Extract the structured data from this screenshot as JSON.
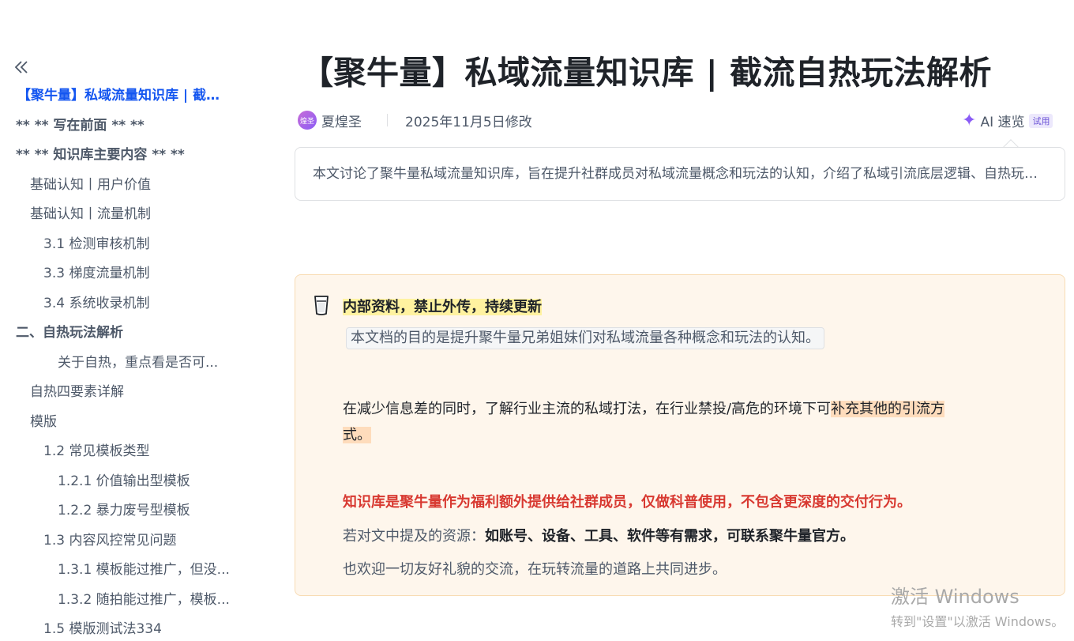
{
  "sidebar": {
    "toc": [
      {
        "label": "【聚牛量】私域流量知识库 | 截流自热玩法解析",
        "level": 0,
        "style": "active"
      },
      {
        "label": "** ** 写在前面 ** **",
        "level": 0,
        "style": "bold"
      },
      {
        "label": "** ** 知识库主要内容 ** **",
        "level": 0,
        "style": "bold"
      },
      {
        "label": "基础认知丨用户价值",
        "level": 1,
        "style": ""
      },
      {
        "label": "基础认知丨流量机制",
        "level": 1,
        "style": ""
      },
      {
        "label": "3.1 检测审核机制",
        "level": 2,
        "style": ""
      },
      {
        "label": "3.3 梯度流量机制",
        "level": 2,
        "style": ""
      },
      {
        "label": "3.4 系统收录机制",
        "level": 2,
        "style": ""
      },
      {
        "label": "二、自热玩法解析",
        "level": 0,
        "style": "bold"
      },
      {
        "label": "关于自热，重点看是否可...",
        "level": 3,
        "style": ""
      },
      {
        "label": "自热四要素详解",
        "level": 1,
        "style": ""
      },
      {
        "label": "模版",
        "level": 1,
        "style": ""
      },
      {
        "label": "1.2 常见模板类型",
        "level": 2,
        "style": ""
      },
      {
        "label": "1.2.1 价值输出型模板",
        "level": 3,
        "style": ""
      },
      {
        "label": "1.2.2 暴力废号型模板",
        "level": 3,
        "style": ""
      },
      {
        "label": "1.3 内容风控常见问题",
        "level": 2,
        "style": ""
      },
      {
        "label": "1.3.1 模板能过推广，但没...",
        "level": 3,
        "style": ""
      },
      {
        "label": "1.3.2 随拍能过推广，模板...",
        "level": 3,
        "style": ""
      },
      {
        "label": "1.5 模版测试法334",
        "level": 2,
        "style": ""
      }
    ]
  },
  "doc": {
    "title": "【聚牛量】私域流量知识库 | 截流自热玩法解析",
    "avatar_text": "煌圣",
    "author": "夏煌圣",
    "modified": "2025年11月5日修改",
    "ai_label": "AI 速览",
    "ai_badge": "试用",
    "summary": "本文讨论了聚牛量私域流量知识库，旨在提升社群成员对私域流量概念和玩法的认知，介绍了私域引流底层逻辑、自热玩法等内容，并强调知识库仅做科普使用。"
  },
  "callout": {
    "heading": "内部资料，禁止外传，持续更新",
    "code_text": "本文档的目的是提升聚牛量兄弟姐妹们对私域流量各种概念和玩法的认知。",
    "p1_a": "在减少信息差的同时，了解行业主流的私域打法，在行业禁投/高危的环境下可",
    "p1_b": "补充其他的引流方",
    "p1_c": "式。",
    "warning": "知识库是聚牛量作为福利额外提供给社群成员，仅做科普使用，不包含更深度的交付行为。",
    "resource_prefix": "若对文中提及的资源：",
    "resource_bold": "如账号、设备、工具、软件等有需求，可联系聚牛量官方。",
    "welcome": "也欢迎一切友好礼貌的交流，在玩转流量的道路上共同进步。"
  },
  "watermark": {
    "title": "激活 Windows",
    "subtitle": "转到\"设置\"以激活 Windows。"
  }
}
